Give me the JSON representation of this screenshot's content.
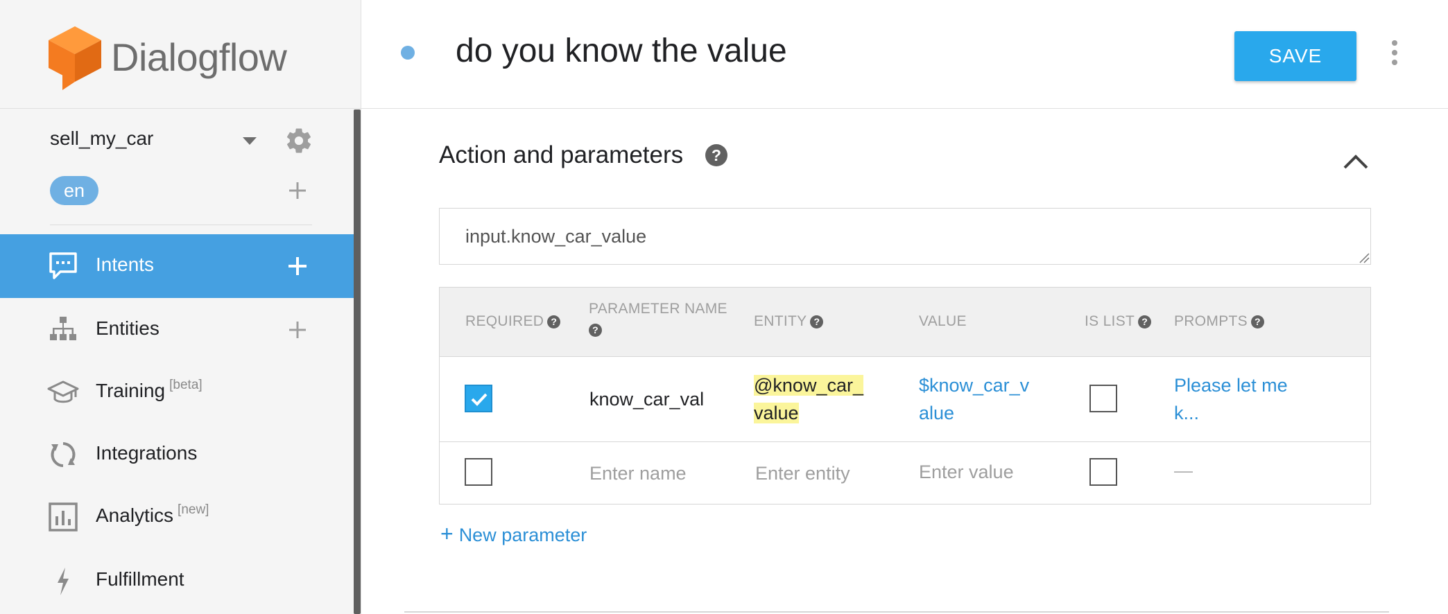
{
  "brand": {
    "name": "Dialogflow"
  },
  "agent": {
    "name": "sell_my_car",
    "language": "en"
  },
  "nav": [
    {
      "label": "Intents",
      "sup": "",
      "has_add": true,
      "active": true
    },
    {
      "label": "Entities",
      "sup": "",
      "has_add": true,
      "active": false
    },
    {
      "label": "Training",
      "sup": "[beta]",
      "has_add": false,
      "active": false
    },
    {
      "label": "Integrations",
      "sup": "",
      "has_add": false,
      "active": false
    },
    {
      "label": "Analytics",
      "sup": "[new]",
      "has_add": false,
      "active": false
    },
    {
      "label": "Fulfillment",
      "sup": "",
      "has_add": false,
      "active": false
    }
  ],
  "header": {
    "intent_title": "do you know the value",
    "save_label": "SAVE"
  },
  "section": {
    "title": "Action and parameters",
    "action_value": "input.know_car_value"
  },
  "table": {
    "headers": [
      "REQUIRED",
      "PARAMETER NAME",
      "ENTITY",
      "VALUE",
      "IS LIST",
      "PROMPTS"
    ],
    "rows": [
      {
        "required": true,
        "name_lines": [
          "know_car_val"
        ],
        "entity_lines": [
          "@know_car_",
          "value"
        ],
        "value_lines": [
          "$know_car_v",
          "alue"
        ],
        "is_list": false,
        "prompts_lines": [
          "Please let me",
          "k..."
        ]
      }
    ],
    "placeholder_row": {
      "name": "Enter name",
      "entity": "Enter entity",
      "value": "Enter value",
      "prompts": "—"
    }
  },
  "new_param_label": "New parameter",
  "colors": {
    "accent": "#29a8ec",
    "nav_active": "#45a0e1",
    "link": "#2b8fd6",
    "entity_highlight": "#fbf59b",
    "logo_orange": "#f47b20"
  },
  "icons": {
    "logo": "dialogflow-logo-icon",
    "settings": "gear-icon",
    "intents": "chat-bubble-icon",
    "entities": "hierarchy-icon",
    "training": "graduation-cap-icon",
    "integrations": "sync-icon",
    "analytics": "bar-chart-icon",
    "fulfillment": "lightning-icon",
    "help": "help-icon",
    "collapse": "chevron-up-icon",
    "more": "more-vert-icon"
  }
}
